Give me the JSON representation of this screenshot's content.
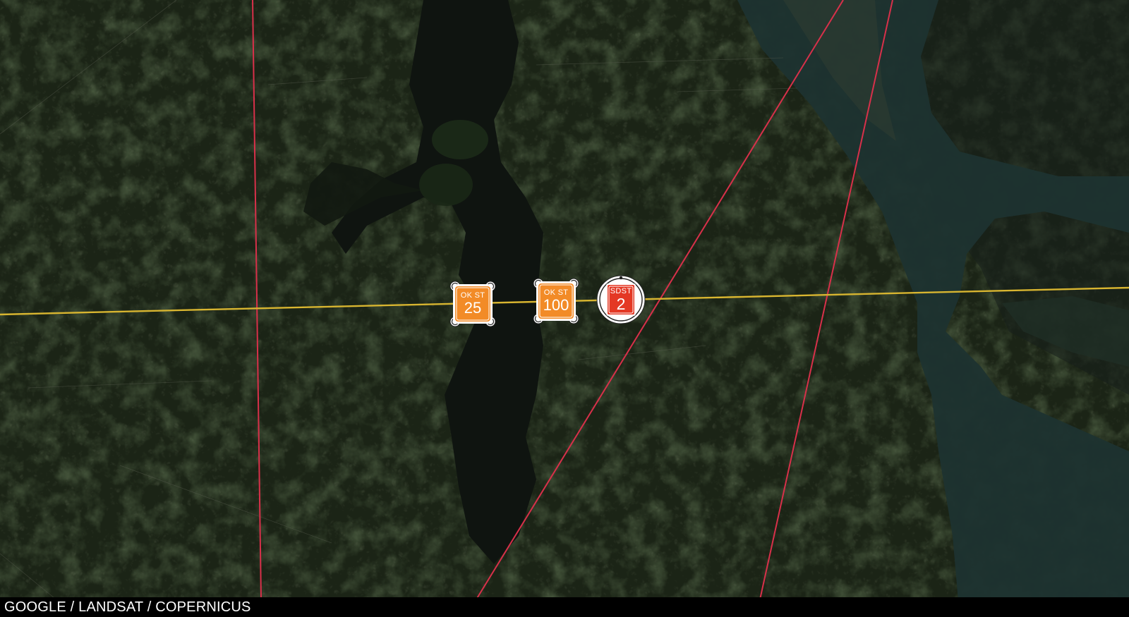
{
  "map": {
    "type": "satellite",
    "attribution": "GOOGLE / LANDSAT / COPERNICUS",
    "colors": {
      "route_line": "#d8b530",
      "boundary_line": "#d8304a",
      "orange_sign": "#f28b27",
      "red_sign": "#e43824"
    },
    "markers": [
      {
        "name": "ok-st-25-marker",
        "top_label": "OK ST",
        "number": "25",
        "style": "orange-square"
      },
      {
        "name": "ok-st-100-marker",
        "top_label": "OK ST",
        "number": "100",
        "style": "orange-square"
      },
      {
        "name": "sdst-2-marker",
        "top_label": "SDST",
        "number": "2",
        "style": "red-circle"
      }
    ]
  }
}
